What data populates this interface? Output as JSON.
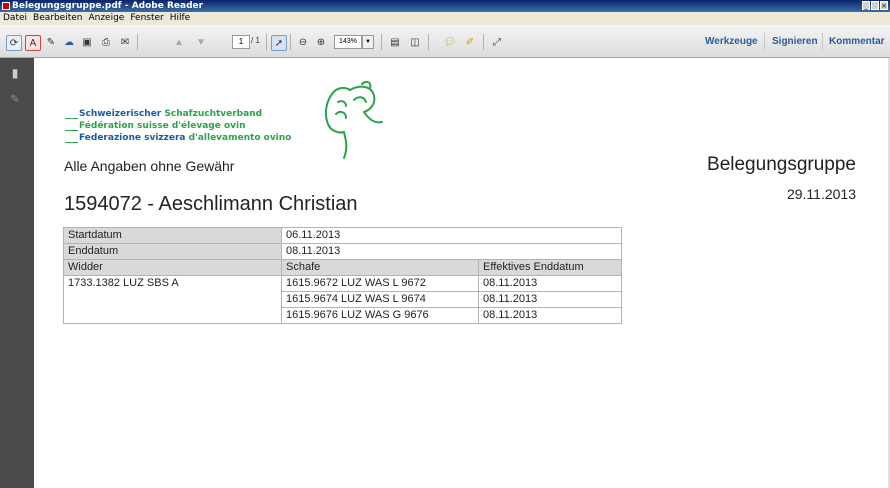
{
  "window": {
    "title": "Belegungsgruppe.pdf - Adobe Reader",
    "controls": [
      "_",
      " ",
      "×"
    ]
  },
  "menu": [
    "Datei",
    "Bearbeiten",
    "Anzeige",
    "Fenster",
    "Hilfe"
  ],
  "toolbar": {
    "page_current": "1",
    "page_total": "/ 1",
    "zoom": "143%",
    "links": [
      "Werkzeuge",
      "Signieren",
      "Kommentar"
    ]
  },
  "document": {
    "logo": {
      "line1_a": "Schweizerischer ",
      "line1_b": "Schafzuchtverband",
      "line2_a": "Fédération suisse ",
      "line2_b": "d'élevage ovin",
      "line3_a": "Federazione svizzera ",
      "line3_b": "d'allevamento ovino"
    },
    "heading": "Belegungsgruppe",
    "date": "29.11.2013",
    "disclaimer": "Alle Angaben ohne Gewähr",
    "breeder": "1594072 - Aeschlimann Christian",
    "table": {
      "startdatum_label": "Startdatum",
      "startdatum_value": "06.11.2013",
      "enddatum_label": "Enddatum",
      "enddatum_value": "08.11.2013",
      "col_widder": "Widder",
      "col_schafe": "Schafe",
      "col_enddatum": "Effektives Enddatum",
      "widder": "1733.1382 LUZ SBS A",
      "rows": [
        {
          "schaf": "1615.9672 LUZ WAS L 9672",
          "enddatum": "08.11.2013"
        },
        {
          "schaf": "1615.9674 LUZ WAS L 9674",
          "enddatum": "08.11.2013"
        },
        {
          "schaf": "1615.9676 LUZ WAS G 9676",
          "enddatum": "08.11.2013"
        }
      ]
    }
  },
  "colors": {
    "logo_blue": "#1a5aa0",
    "logo_green": "#2aa34a",
    "link_blue": "#2a5d96",
    "nav_pane": "#4a4a4a"
  }
}
